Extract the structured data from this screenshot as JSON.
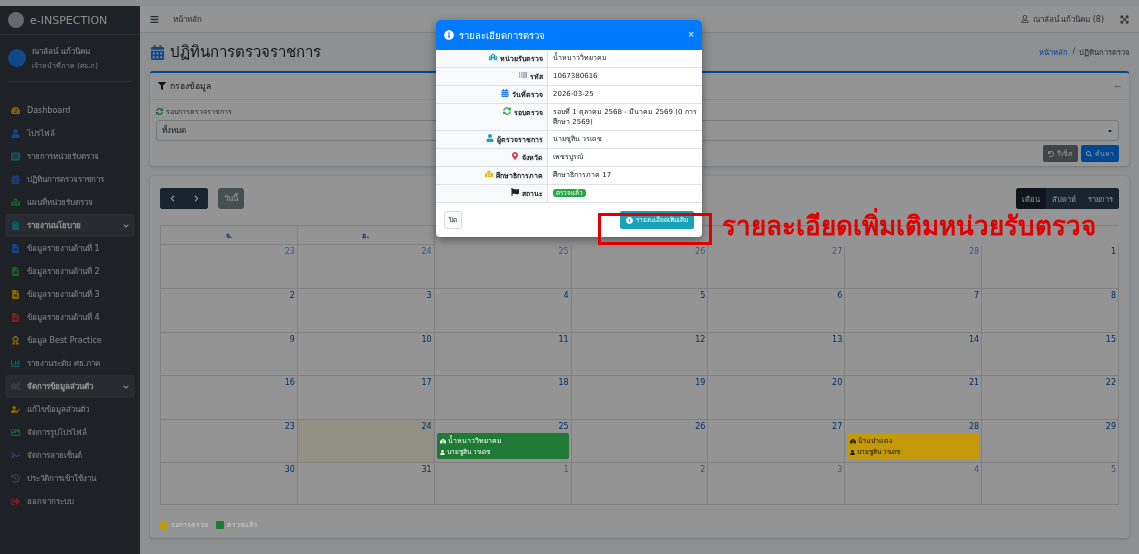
{
  "brand": "e-INSPECTION",
  "user": {
    "name": "ณาลัลน์ แก้วนิคม",
    "role": "เจ้าหน้าที่ภาค (ศธ.ภ)"
  },
  "sidebar": {
    "items": [
      {
        "kind": "link",
        "label": "Dashboard"
      },
      {
        "kind": "link",
        "label": "โปรไฟล์"
      },
      {
        "kind": "link",
        "label": "รายการหน่วยรับตรวจ"
      },
      {
        "kind": "link",
        "label": "ปฏิทินการตรวจราชการ"
      },
      {
        "kind": "link",
        "label": "แผนที่หน่วยรับตรวจ"
      },
      {
        "kind": "group",
        "label": "รายงานนโยบาย",
        "expanded": true,
        "children": [
          {
            "kind": "link",
            "label": "ข้อมูลรายงานด้านที่ 1"
          },
          {
            "kind": "link",
            "label": "ข้อมูลรายงานด้านที่ 2"
          },
          {
            "kind": "link",
            "label": "ข้อมูลรายงานด้านที่ 3"
          },
          {
            "kind": "link",
            "label": "ข้อมูลรายงานด้านที่ 4"
          },
          {
            "kind": "link",
            "label": "ข้อมูล Best Practice"
          },
          {
            "kind": "link",
            "label": "รายงานระดับ ศธ.ภาค"
          }
        ]
      },
      {
        "kind": "group",
        "label": "จัดการข้อมูลส่วนตัว",
        "expanded": true,
        "children": [
          {
            "kind": "link",
            "label": "แก้ไขข้อมูลส่วนตัว"
          },
          {
            "kind": "link",
            "label": "จัดการรูปโปรไฟล์"
          },
          {
            "kind": "link",
            "label": "จัดการลายเซ็นต์"
          },
          {
            "kind": "link",
            "label": "ประวัติการเข้าใช้งาน"
          },
          {
            "kind": "link",
            "label": "ออกจากระบบ"
          }
        ]
      }
    ]
  },
  "navbar": {
    "home": "หน้าหลัก",
    "account": "ณาลัลน์ แก้วนิคม (8)"
  },
  "page_title": "ปฏิทินการตรวจราชการ",
  "breadcrumb": {
    "separator": "/",
    "items": [
      {
        "label": "หน้าหลัก",
        "link": true
      },
      {
        "label": "ปฏิทินการตรวจ",
        "link": false
      }
    ]
  },
  "filter": {
    "title": "กรองข้อมูล",
    "field_label": "รอบการตรวจราชการ",
    "value": "ทั้งหมด",
    "buttons": [
      {
        "label": "รีเซ็ต",
        "kind": "reset"
      },
      {
        "label": "ค้นหา",
        "kind": "search"
      }
    ]
  },
  "calendar": {
    "today_button": "วันนี้",
    "views": [
      {
        "label": "เดือน",
        "selected": true
      },
      {
        "label": "สัปดาห์",
        "selected": false
      },
      {
        "label": "รายการ",
        "selected": false
      }
    ],
    "weekdays": [
      "จ.",
      "อ."
    ],
    "weeks": [
      [
        {
          "day": "23",
          "outside": true
        },
        {
          "day": "24",
          "outside": true
        },
        {
          "day": "25",
          "outside": true
        },
        {
          "day": "26",
          "outside": true
        },
        {
          "day": "27",
          "outside": true
        },
        {
          "day": "28",
          "outside": true
        },
        {
          "day": "1",
          "outside": false
        }
      ],
      [
        {
          "day": "2",
          "outside": false
        },
        {
          "day": "3",
          "outside": false
        },
        {
          "day": "4",
          "outside": false
        },
        {
          "day": "5",
          "outside": false
        },
        {
          "day": "6",
          "outside": false
        },
        {
          "day": "7",
          "outside": false
        },
        {
          "day": "8",
          "outside": false
        }
      ],
      [
        {
          "day": "9",
          "outside": false
        },
        {
          "day": "10",
          "outside": false
        },
        {
          "day": "11",
          "outside": false
        },
        {
          "day": "12",
          "outside": false
        },
        {
          "day": "13",
          "outside": false
        },
        {
          "day": "14",
          "outside": false
        },
        {
          "day": "15",
          "outside": false
        }
      ],
      [
        {
          "day": "16",
          "outside": false
        },
        {
          "day": "17",
          "outside": false
        },
        {
          "day": "18",
          "outside": false
        },
        {
          "day": "19",
          "outside": false
        },
        {
          "day": "20",
          "outside": false
        },
        {
          "day": "21",
          "outside": false
        },
        {
          "day": "22",
          "outside": false
        }
      ],
      [
        {
          "day": "23",
          "outside": false,
          "today": false
        },
        {
          "day": "24",
          "outside": false,
          "today": true
        },
        {
          "day": "25",
          "outside": false,
          "events": [
            {
              "title": "น้ำหนาววิทยาคม",
              "inspector": "นายชูสิน วรเดช",
              "color": "#1e7a35"
            }
          ]
        },
        {
          "day": "26",
          "outside": false
        },
        {
          "day": "27",
          "outside": false
        },
        {
          "day": "28",
          "outside": false,
          "events": [
            {
              "title": "บ้านป่าแดง",
              "inspector": "นายชูสิน วรเดช",
              "color": "#c49a0a"
            }
          ]
        },
        {
          "day": "29",
          "outside": false
        }
      ],
      [
        {
          "day": "30",
          "outside": false
        },
        {
          "day": "31",
          "outside": false
        },
        {
          "day": "1",
          "outside": true
        },
        {
          "day": "2",
          "outside": true
        },
        {
          "day": "3",
          "outside": true
        },
        {
          "day": "4",
          "outside": true
        },
        {
          "day": "5",
          "outside": true
        }
      ]
    ],
    "legend": [
      {
        "label": "รอการตรวจ",
        "color": "#c49a0a"
      },
      {
        "label": "ตรวจแล้ว",
        "color": "#1e7a35"
      }
    ]
  },
  "modal": {
    "title": "รายละเอียดการตรวจ",
    "close_glyph": "×",
    "rows": [
      {
        "label": "หน่วยรับตรวจ",
        "value": "น้ำหนาววิทยาคม",
        "kind": "text"
      },
      {
        "label": "รหัส",
        "value": "1067380616",
        "kind": "text"
      },
      {
        "label": "วันที่ตรวจ",
        "value": "2026-03-25",
        "kind": "text"
      },
      {
        "label": "รอบตรวจ",
        "value": "รอบที่ 1 ตุลาคม 2568 - มีนาคม 2569 (0 การศึกษา 2569)",
        "kind": "text"
      },
      {
        "label": "ผู้ตรวจราชการ",
        "value": "นายชูสิน วรเดช",
        "kind": "text"
      },
      {
        "label": "จังหวัด",
        "value": "เพชรบูรณ์",
        "kind": "text"
      },
      {
        "label": "ศึกษาธิการภาค",
        "value": "ศึกษาธิการภาค 17",
        "kind": "text"
      },
      {
        "label": "สถานะ",
        "value": "ตรวจแล้ว",
        "kind": "badge"
      }
    ],
    "close": "ปิด",
    "more": "รายละเอียดเพิ่มเติม"
  },
  "annotation": {
    "text": "รายละเอียดเพิ่มเติมหน่วยรับตรวจ"
  }
}
